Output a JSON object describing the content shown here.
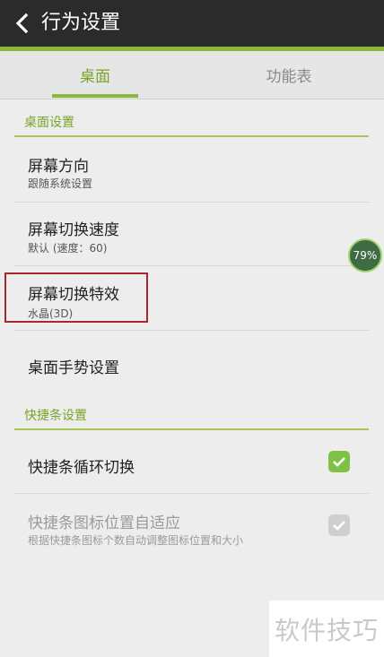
{
  "header": {
    "title": "行为设置",
    "back_icon": "back-chevron-icon"
  },
  "tabs": [
    {
      "label": "桌面",
      "active": true
    },
    {
      "label": "功能表",
      "active": false
    }
  ],
  "sections": [
    {
      "label": "桌面设置",
      "items": [
        {
          "title": "屏幕方向",
          "subtitle": "跟随系统设置"
        },
        {
          "title": "屏幕切换速度",
          "subtitle": "默认 (速度：60)"
        },
        {
          "title": "屏幕切换特效",
          "subtitle": "水晶(3D)"
        },
        {
          "title": "桌面手势设置",
          "subtitle": ""
        }
      ]
    },
    {
      "label": "快捷条设置",
      "items": [
        {
          "title": "快捷条循环切换",
          "subtitle": "",
          "checked": true,
          "enabled": true
        },
        {
          "title": "快捷条图标位置自适应",
          "subtitle": "根据快捷条图标个数自动调整图标位置和大小",
          "checked": true,
          "enabled": false
        }
      ]
    }
  ],
  "float_badge": {
    "text": "79%"
  },
  "watermark": {
    "text": "软件技巧"
  },
  "colors": {
    "accent": "#8cb83a",
    "header_bg": "#2b2b2b",
    "highlight": "#a5282c",
    "checkbox_on": "#7ec144"
  }
}
